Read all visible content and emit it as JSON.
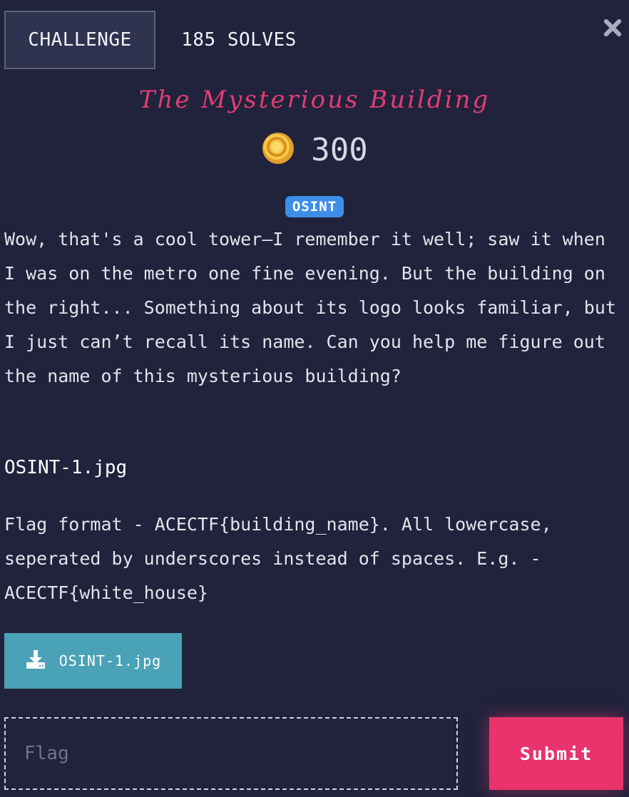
{
  "header": {
    "tab_challenge": "CHALLENGE",
    "tab_solves": "185 SOLVES",
    "close_icon": "close-x-icon"
  },
  "challenge": {
    "title": "The Mysterious Building",
    "points": "300",
    "points_icon": "gold-coin-icon",
    "category": "OSINT",
    "description": "Wow, that's a cool tower—I remember it well; saw it when I was on the metro one fine evening. But the building on the right... Something about its logo looks familiar, but I just can’t recall its name. Can you help me figure out the name of this mysterious building?",
    "file_name": "OSINT-1.jpg",
    "flag_format": "Flag format - ACECTF{building_name}. All lowercase, seperated by underscores instead of spaces. E.g. - ACECTF{white_house}"
  },
  "download": {
    "label": "OSINT-1.jpg",
    "icon": "download-icon"
  },
  "form": {
    "flag_placeholder": "Flag",
    "flag_value": "",
    "submit_label": "Submit"
  },
  "colors": {
    "background": "#20233b",
    "title": "#e33d76",
    "badge": "#3d8ee8",
    "download_button": "#4aa2b6",
    "submit_button": "#e8336c"
  }
}
